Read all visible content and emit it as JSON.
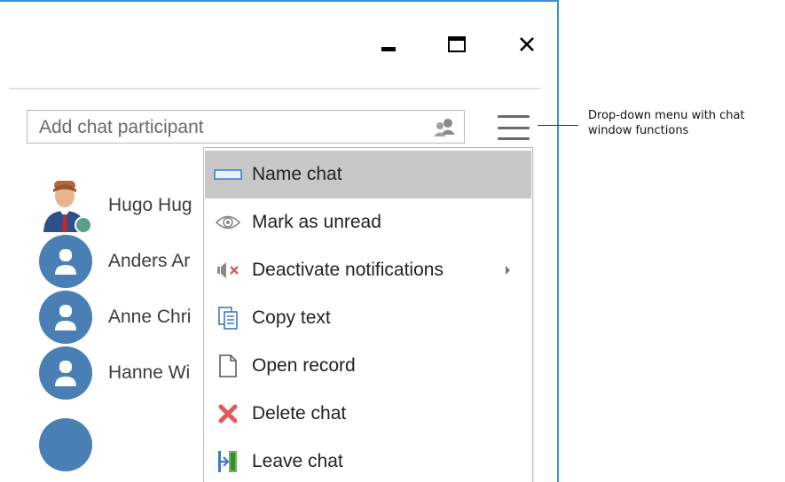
{
  "window": {
    "controls": {
      "minimize": "minimize",
      "maximize": "maximize",
      "close": "close"
    }
  },
  "search": {
    "placeholder": "Add chat participant",
    "icon": "add-people-icon"
  },
  "menu_button": {
    "icon": "hamburger-menu-icon"
  },
  "participants": [
    {
      "name": "Hugo Hug",
      "avatar": "photo"
    },
    {
      "name": "Anders Ar",
      "avatar": "generic-user"
    },
    {
      "name": "Anne Chri",
      "avatar": "generic-user"
    },
    {
      "name": "Hanne Wi",
      "avatar": "generic-user"
    }
  ],
  "menu": {
    "items": [
      {
        "label": "Name chat",
        "icon": "rename-field-icon",
        "highlighted": true
      },
      {
        "label": "Mark as unread",
        "icon": "eye-icon"
      },
      {
        "label": "Deactivate notifications",
        "icon": "speaker-mute-icon",
        "submenu": true
      },
      {
        "label": "Copy text",
        "icon": "copy-document-icon"
      },
      {
        "label": "Open record",
        "icon": "page-icon"
      },
      {
        "label": "Delete chat",
        "icon": "red-x-icon"
      },
      {
        "label": "Leave chat",
        "icon": "exit-door-icon"
      }
    ]
  },
  "callout": {
    "text": "Drop-down menu with chat window functions"
  },
  "colors": {
    "window_border": "#3c8fd6",
    "avatar_blue": "#4a7fb5",
    "menu_highlight": "#c8c8c8",
    "delete_red": "#e05a5a"
  }
}
